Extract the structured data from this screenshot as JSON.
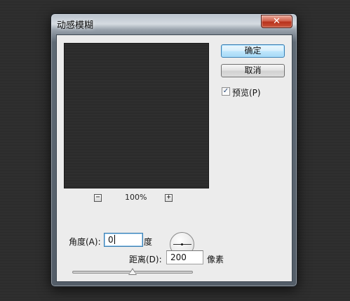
{
  "dialog": {
    "title": "动感模糊",
    "close_glyph": "✕",
    "accent_color": "#a7d9f5",
    "close_color": "#c0392b"
  },
  "buttons": {
    "ok_label": "确定",
    "cancel_label": "取消"
  },
  "preview": {
    "checkbox_label": "预览(P)",
    "checked": true,
    "check_glyph": "✓",
    "zoom_level": "100%",
    "zoom_out_glyph": "−",
    "zoom_in_glyph": "+"
  },
  "angle": {
    "label": "角度(A):",
    "value": "0",
    "unit": "度"
  },
  "distance": {
    "label": "距离(D):",
    "value": "200",
    "unit": "像素",
    "slider_fraction": 0.5
  }
}
